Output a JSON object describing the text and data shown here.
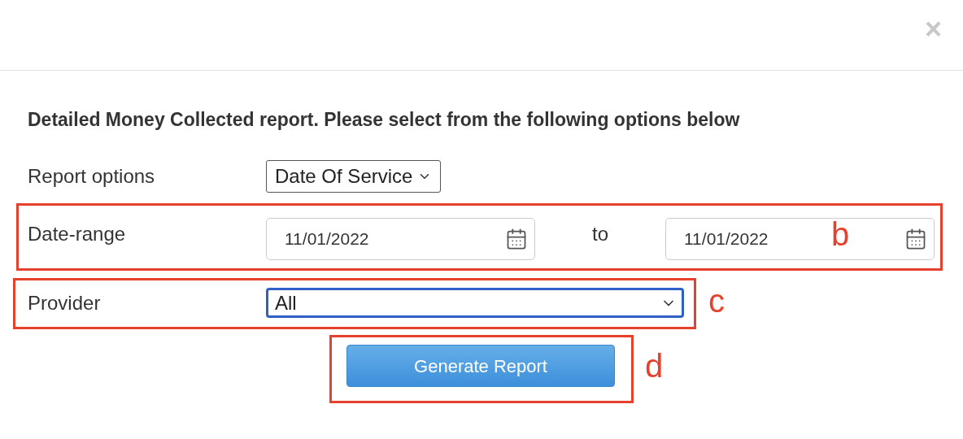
{
  "dialog": {
    "close": "×",
    "heading": "Detailed Money Collected report. Please select from the following options below",
    "report_options": {
      "label": "Report options",
      "value": "Date Of Service"
    },
    "date_range": {
      "label": "Date-range",
      "from": "11/01/2022",
      "separator": "to",
      "to": "11/01/2022"
    },
    "provider": {
      "label": "Provider",
      "value": "All",
      "focused": true
    },
    "button": "Generate Report"
  },
  "annotations": [
    {
      "label": "b"
    },
    {
      "label": "c"
    },
    {
      "label": "d"
    }
  ]
}
